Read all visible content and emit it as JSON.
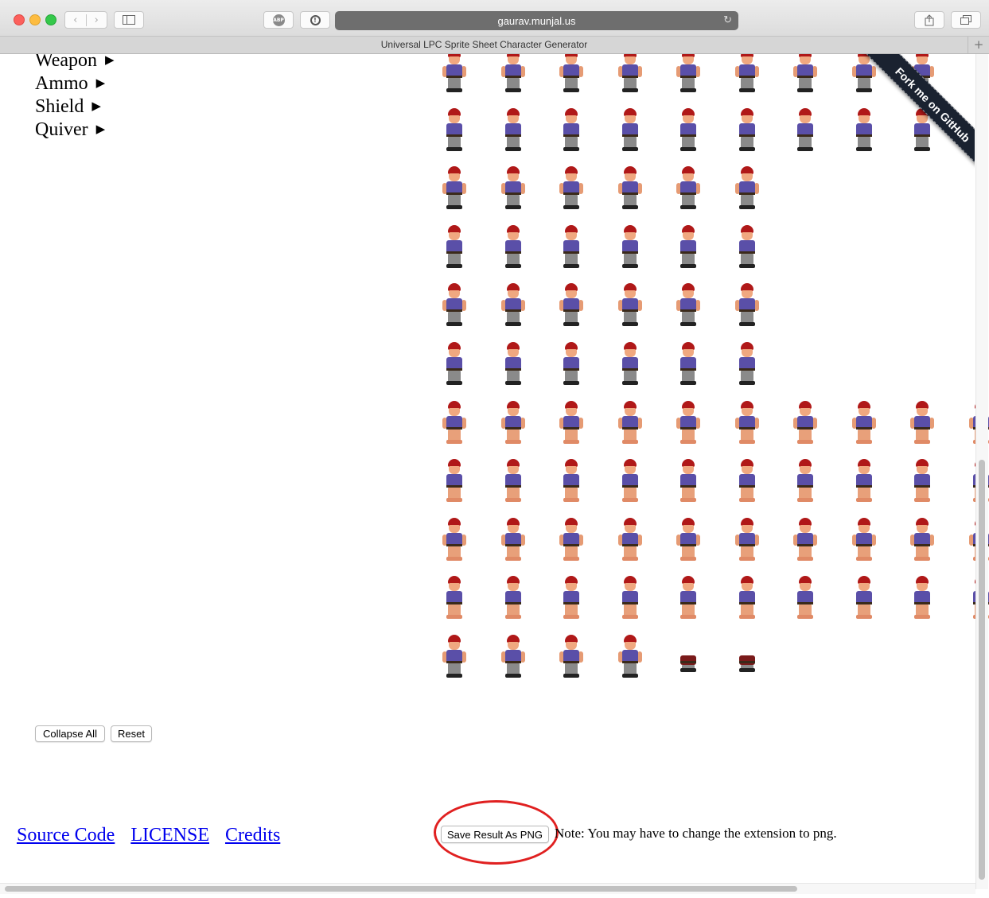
{
  "browser": {
    "url": "gaurav.munjal.us",
    "tab_title": "Universal LPC Sprite Sheet Character Generator",
    "new_tab_symbol": "+",
    "adblock_label": "ABP"
  },
  "categories": [
    {
      "label": "Weapon",
      "arrow": "▶"
    },
    {
      "label": "Ammo",
      "arrow": "▶"
    },
    {
      "label": "Shield",
      "arrow": "▶"
    },
    {
      "label": "Quiver",
      "arrow": "▶"
    }
  ],
  "buttons": {
    "collapse_all": "Collapse All",
    "reset": "Reset",
    "save_png": "Save Result As PNG"
  },
  "footer_links": {
    "source_code": "Source Code",
    "license": "LICENSE",
    "credits": "Credits"
  },
  "note": "Note: You may have to change the extension to png.",
  "ribbon": "Fork me on GitHub",
  "sprite_rows": [
    9,
    9,
    6,
    6,
    6,
    6,
    10,
    10,
    10,
    10,
    6
  ],
  "colors": {
    "link": "#0000ee",
    "highlight_circle": "#e02020",
    "ribbon_bg": "#1a2230",
    "sprite_hair": "#b01818",
    "sprite_shirt": "#5a4fa8"
  }
}
